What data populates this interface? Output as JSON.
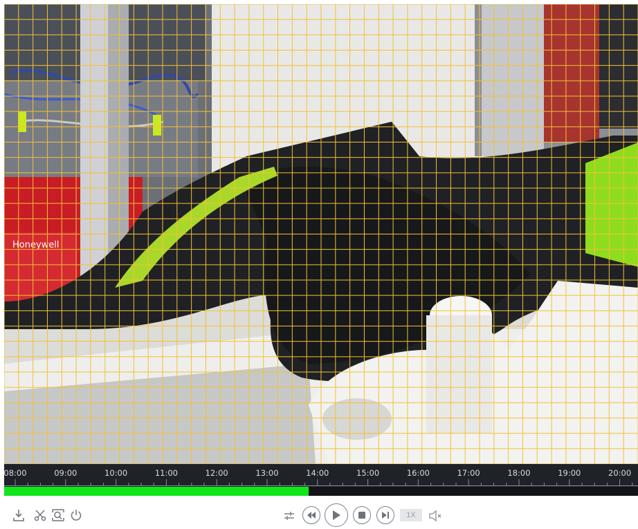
{
  "timeline": {
    "labels": [
      "08:00",
      "09:00",
      "10:00",
      "11:00",
      "12:00",
      "13:00",
      "14:00",
      "15:00",
      "16:00",
      "17:00",
      "18:00",
      "19:00",
      "20:00"
    ],
    "recorded_fraction": 0.48,
    "record_color": "#11e61b",
    "background_color": "#1f2228"
  },
  "video": {
    "grid_color": "#f3c233"
  },
  "toolbar_left": {
    "icons": [
      "download-icon",
      "scissors-icon",
      "zoom-frame-icon",
      "power-icon"
    ]
  },
  "playback": {
    "speed": "1X",
    "icons": [
      "adjust-icon",
      "rewind-icon",
      "play-icon",
      "stop-icon",
      "next-frame-icon",
      "mute-icon"
    ]
  }
}
